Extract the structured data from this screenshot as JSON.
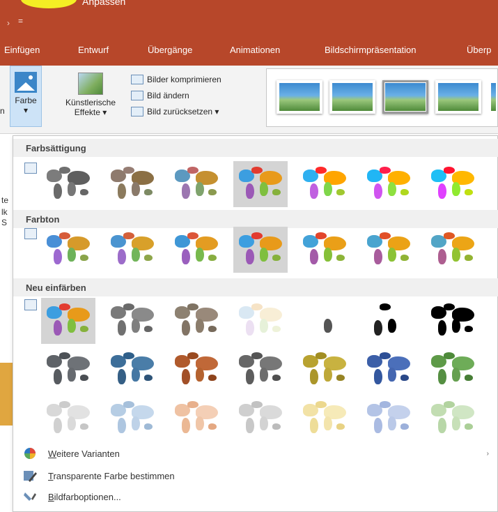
{
  "title": {
    "text": "Anpassen"
  },
  "qat": {
    "arrow": "›",
    "customize": "="
  },
  "tabs": [
    {
      "label": "Einfügen"
    },
    {
      "label": "Entwurf"
    },
    {
      "label": "Übergänge"
    },
    {
      "label": "Animationen"
    },
    {
      "label": "Bildschirmpräsentation"
    },
    {
      "label": "Überp"
    }
  ],
  "ribbon": {
    "left_fragment": "n",
    "farbe": {
      "label": "Farbe",
      "arrow": "▾"
    },
    "kuenstlerische": {
      "line1": "Künstlerische",
      "line2": "Effekte ▾"
    },
    "small_commands": [
      {
        "label": "Bilder komprimieren"
      },
      {
        "label": "Bild ändern"
      },
      {
        "label": "Bild zurücksetzen  ▾"
      }
    ]
  },
  "behind_fragments": [
    "te",
    "lk",
    "S"
  ],
  "menu": {
    "sections": [
      {
        "title": "Farbsättigung",
        "selected_index": 3,
        "thumbs": [
          {
            "colors": [
              "#7c7c7c",
              "#6f6f6f",
              "#5f5f5f",
              "#6a6a6a",
              "#777777",
              "#666666"
            ]
          },
          {
            "colors": [
              "#8e7a6d",
              "#967d73",
              "#8b6f44",
              "#8b7a5d",
              "#8a7a6a",
              "#7d8a64"
            ]
          },
          {
            "colors": [
              "#5c99c0",
              "#c06565",
              "#c59030",
              "#9b76b0",
              "#7fa36d",
              "#8b9a4f"
            ]
          },
          {
            "colors": [
              "#3c9ee0",
              "#e23b2f",
              "#e89a1a",
              "#9b59b6",
              "#7fbf3f",
              "#86b13c"
            ]
          },
          {
            "colors": [
              "#2fb0f0",
              "#ff2a2a",
              "#ffa500",
              "#c060e0",
              "#7fd64a",
              "#a0c830"
            ]
          },
          {
            "colors": [
              "#21b6f5",
              "#ff1f4c",
              "#ffb000",
              "#d054f0",
              "#8ee040",
              "#b0d81e"
            ]
          },
          {
            "colors": [
              "#1ebff5",
              "#ff1430",
              "#ffb800",
              "#e040ff",
              "#90ea30",
              "#c0e010"
            ]
          }
        ]
      },
      {
        "title": "Farbton",
        "selected_index": 3,
        "thumbs": [
          {
            "colors": [
              "#4a8fd6",
              "#d65c3a",
              "#d69a2a",
              "#9d69d0",
              "#6eb25a",
              "#8aa44a"
            ]
          },
          {
            "colors": [
              "#4a94d0",
              "#d4603a",
              "#d8a02a",
              "#9c6cc9",
              "#72b55a",
              "#8ea64a"
            ]
          },
          {
            "colors": [
              "#3f97d6",
              "#dc5538",
              "#e39c22",
              "#9a5fbe",
              "#78b94d",
              "#88ad40"
            ]
          },
          {
            "colors": [
              "#3c9ee0",
              "#e23b2f",
              "#e89a1a",
              "#9b59b6",
              "#7fbf3f",
              "#86b13c"
            ]
          },
          {
            "colors": [
              "#43a2d8",
              "#e2452b",
              "#ea9f18",
              "#a35aa8",
              "#86c039",
              "#8db438"
            ]
          },
          {
            "colors": [
              "#4aa4cf",
              "#e14f27",
              "#eba216",
              "#a85c9c",
              "#8cc236",
              "#90b435"
            ]
          },
          {
            "colors": [
              "#52a5c6",
              "#df5823",
              "#eca516",
              "#ad5e90",
              "#92c332",
              "#93b332"
            ]
          }
        ]
      },
      {
        "title": "Neu einfärben",
        "selected_index": 0,
        "rows": [
          [
            {
              "colors": [
                "#3c9ee0",
                "#e23b2f",
                "#e89a1a",
                "#9b59b6",
                "#7fbf3f",
                "#86b13c"
              ]
            },
            {
              "colors": [
                "#7a7a7a",
                "#6a6a6a",
                "#8a8a8a",
                "#707070",
                "#7f7f7f",
                "#666666"
              ]
            },
            {
              "colors": [
                "#8d8171",
                "#7f7363",
                "#99897a",
                "#827465",
                "#8b7d6c",
                "#776a5b"
              ]
            },
            {
              "colors": [
                "#d9e8f3",
                "#f6e3c6",
                "#f8eed6",
                "#ece0f2",
                "#e6f1d9",
                "#eef2d9"
              ]
            },
            {
              "colors": [
                "#ffffff",
                "#ffffff",
                "#ffffff",
                "#ffffff",
                "#555555",
                "#ffffff"
              ]
            },
            {
              "colors": [
                "#ffffff",
                "#000000",
                "#ffffff",
                "#222222",
                "#000000",
                "#ffffff"
              ]
            },
            {
              "colors": [
                "#000000",
                "#000000",
                "#000000",
                "#000000",
                "#000000",
                "#000000"
              ]
            }
          ],
          [
            {
              "colors": [
                "#5f6368",
                "#4d5156",
                "#6e7277",
                "#575b60",
                "#666a6f",
                "#4a4e53"
              ]
            },
            {
              "colors": [
                "#3d6e99",
                "#2f5f8a",
                "#4a7da8",
                "#355f85",
                "#4577a3",
                "#2e5478"
              ]
            },
            {
              "colors": [
                "#b05a2c",
                "#9a4a20",
                "#c06838",
                "#a25028",
                "#b5622f",
                "#8e431c"
              ]
            },
            {
              "colors": [
                "#676767",
                "#555555",
                "#777777",
                "#5d5d5d",
                "#6d6d6d",
                "#505050"
              ]
            },
            {
              "colors": [
                "#b8a230",
                "#a28e22",
                "#c8b240",
                "#ab962a",
                "#bea838",
                "#978424"
              ]
            },
            {
              "colors": [
                "#3c5fa8",
                "#2d4f96",
                "#4b6fba",
                "#33579f",
                "#4466b0",
                "#2a4888"
              ]
            },
            {
              "colors": [
                "#5e9a48",
                "#4e8a3a",
                "#6eac58",
                "#558f42",
                "#66a050",
                "#477e36"
              ]
            }
          ],
          [
            {
              "colors": [
                "#d8d8d8",
                "#cccccc",
                "#e2e2e2",
                "#d0d0d0",
                "#dadada",
                "#c6c6c6"
              ]
            },
            {
              "colors": [
                "#b6cde4",
                "#a6c0db",
                "#c5d8ec",
                "#aec6e0",
                "#bed2e8",
                "#9fbad6"
              ]
            },
            {
              "colors": [
                "#efc2a3",
                "#e8b08c",
                "#f4cfb6",
                "#ebb894",
                "#f0c6a8",
                "#e4a882"
              ]
            },
            {
              "colors": [
                "#cfcfcf",
                "#c2c2c2",
                "#dadada",
                "#c8c8c8",
                "#d3d3d3",
                "#bcbcbc"
              ]
            },
            {
              "colors": [
                "#f2e2a6",
                "#ecd88e",
                "#f6eab8",
                "#eedd98",
                "#f3e4ac",
                "#e8d284"
              ]
            },
            {
              "colors": [
                "#b4c4e6",
                "#a3b6df",
                "#c4d1ec",
                "#aabbe2",
                "#bac9e8",
                "#9cb0da"
              ]
            },
            {
              "colors": [
                "#c2ddb2",
                "#b2d39f",
                "#d0e6c4",
                "#b8d7a8",
                "#c7e0b8",
                "#abcf98"
              ]
            }
          ]
        ]
      }
    ],
    "commands": [
      {
        "accel": "W",
        "rest": "eitere Varianten",
        "has_submenu": true,
        "submenu_arrow": "›"
      },
      {
        "accel": "T",
        "rest": "ransparente Farbe bestimmen",
        "has_submenu": false
      },
      {
        "accel": "B",
        "rest": "ildfarboptionen...",
        "has_submenu": false
      }
    ]
  },
  "colors": {
    "accent": "#b7472a",
    "highlight": "#f4ee24",
    "selected": "#d4d4d4"
  }
}
